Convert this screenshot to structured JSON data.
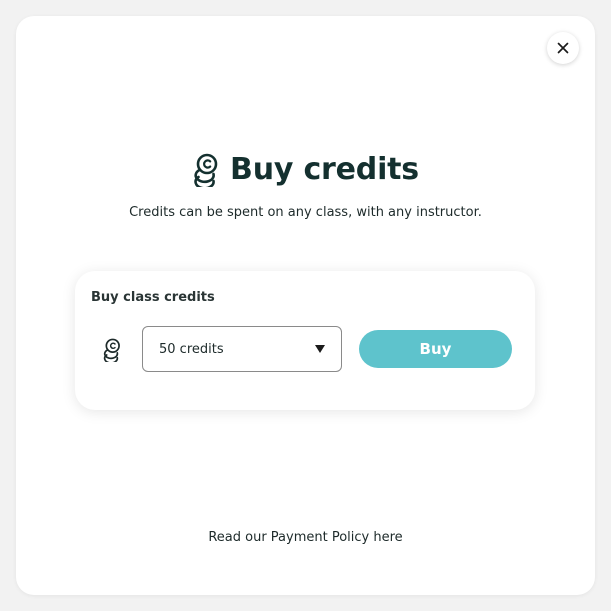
{
  "modal": {
    "title": "Buy credits",
    "subtitle": "Credits can be spent on any class, with any instructor.",
    "close_icon": "close-icon",
    "title_icon": "coins-icon"
  },
  "card": {
    "label": "Buy class credits",
    "coin_icon": "coins-icon",
    "select": {
      "value": "50 credits"
    },
    "buy_label": "Buy",
    "buy_color": "#5ec3cc"
  },
  "footer": {
    "policy_text": "Read our Payment Policy here"
  }
}
